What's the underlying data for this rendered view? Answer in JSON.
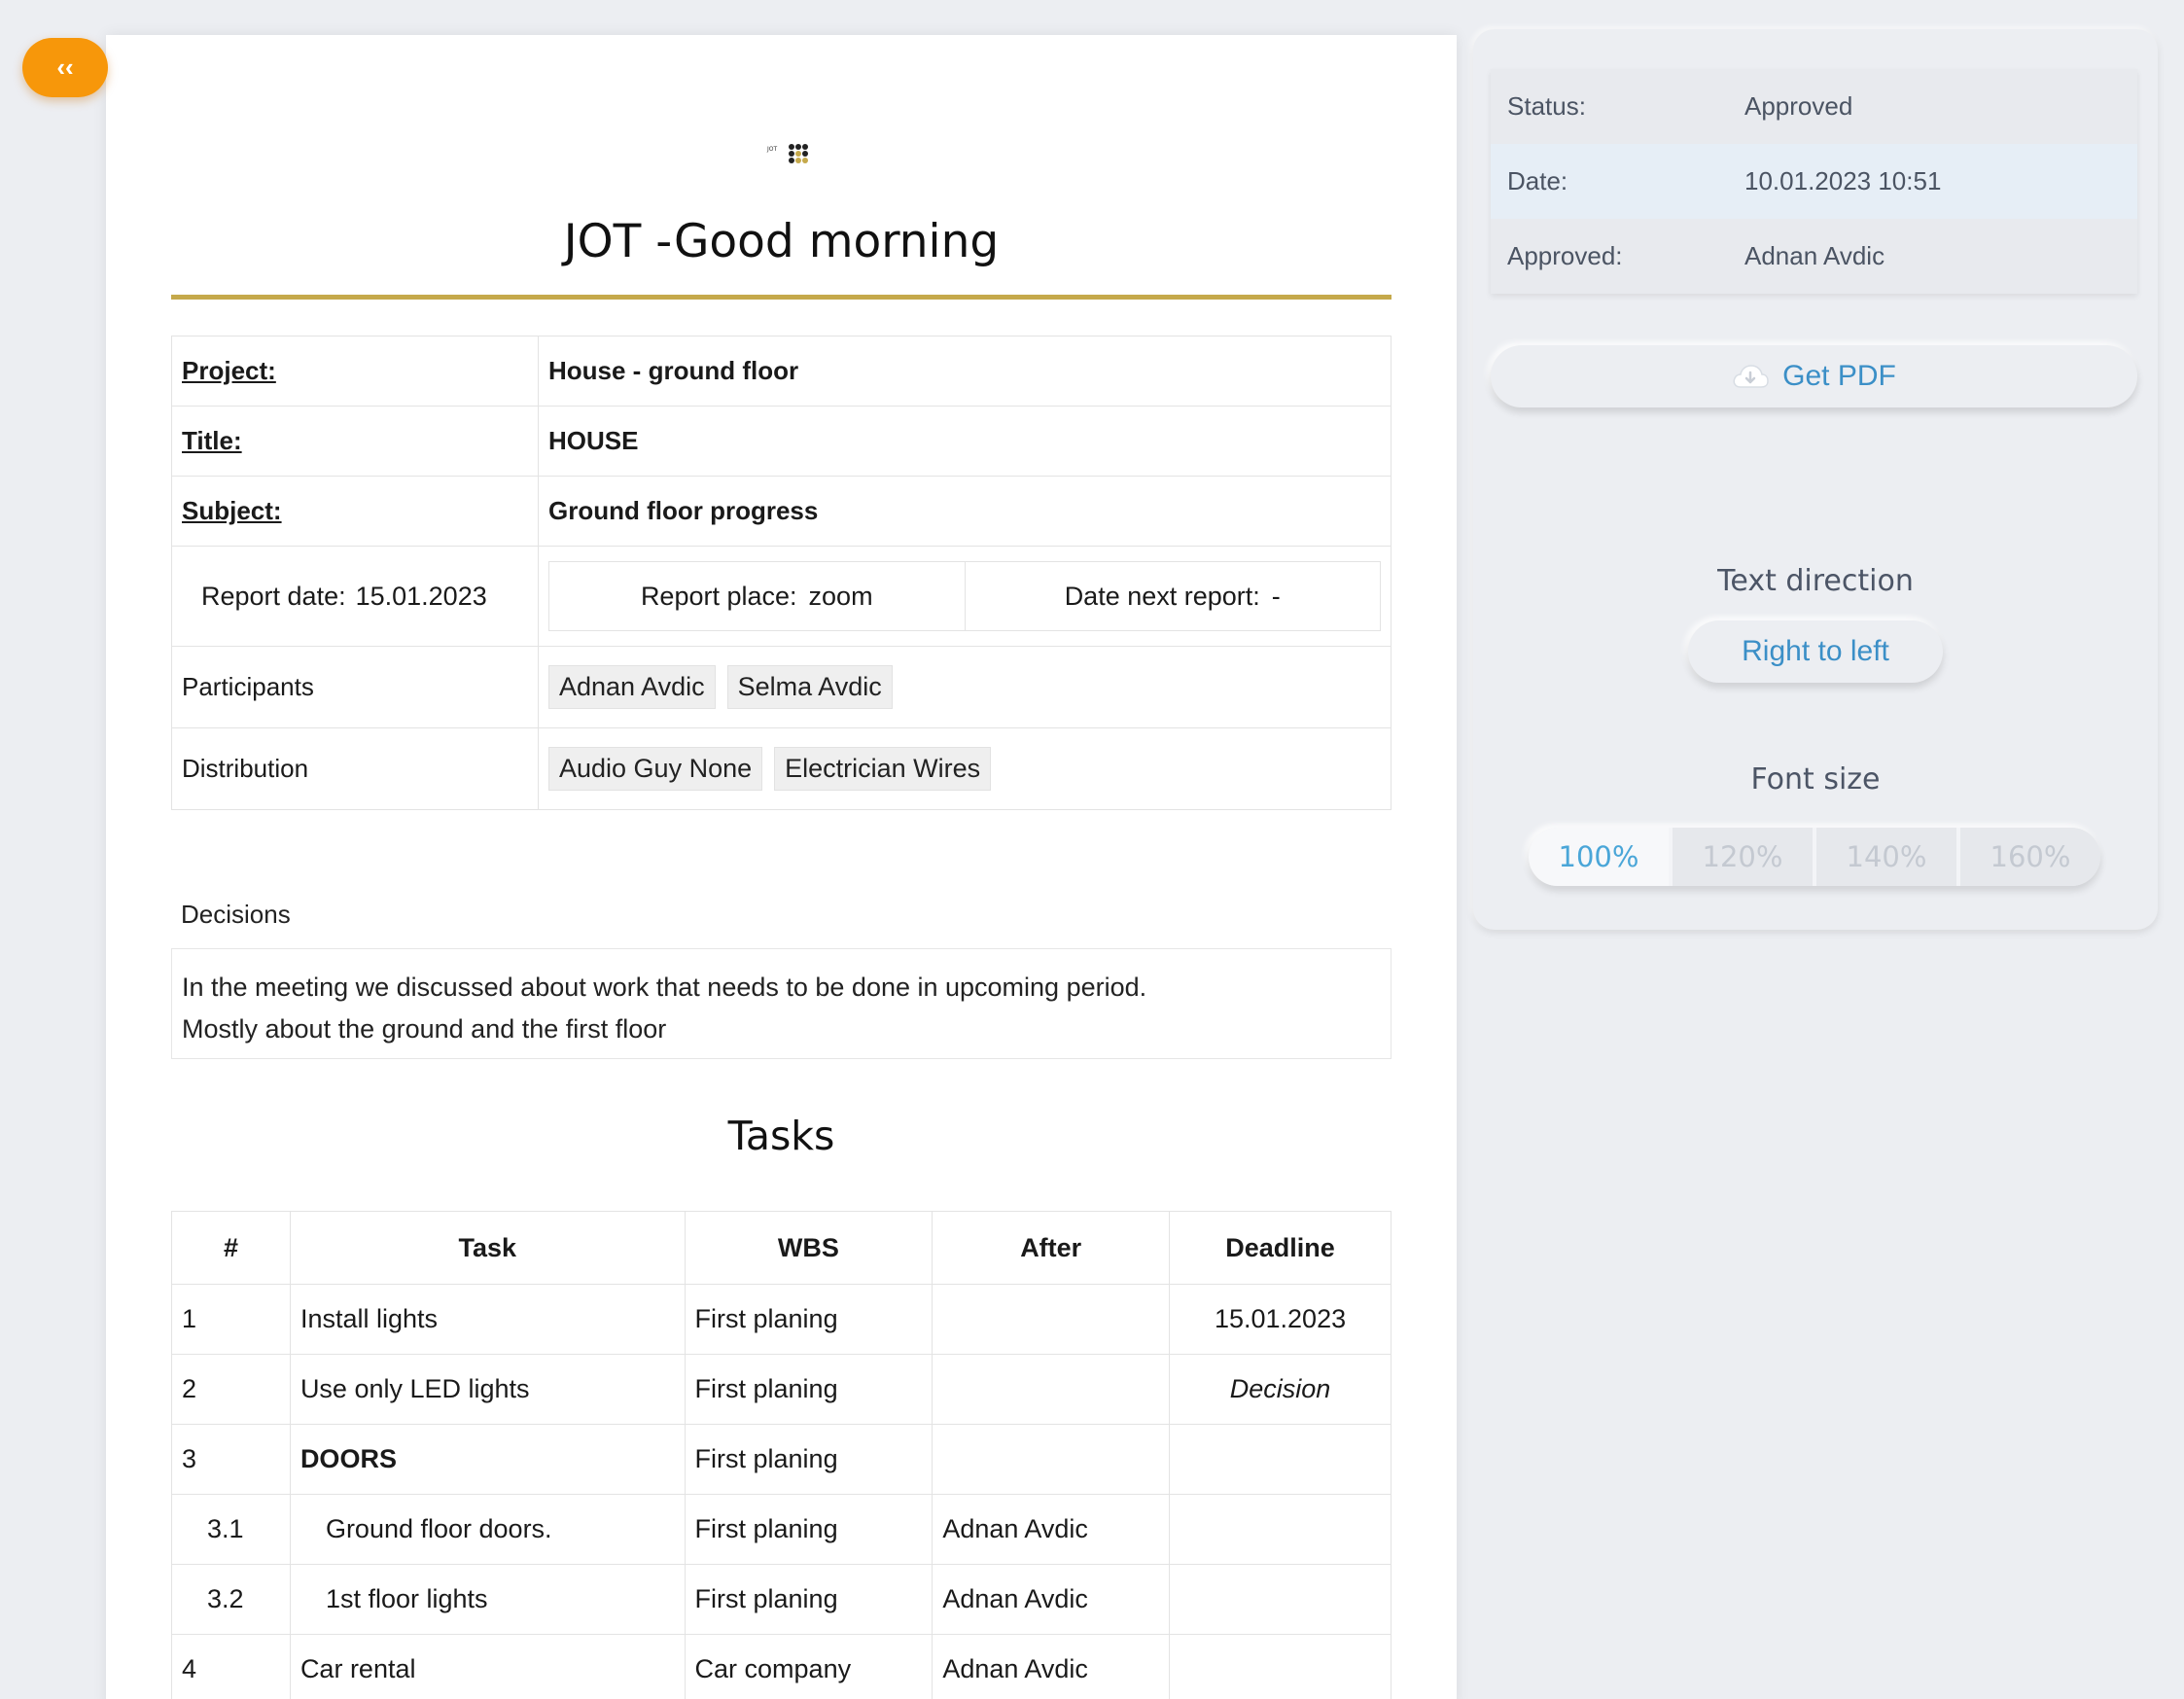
{
  "nav": {
    "back_label": "‹‹"
  },
  "document": {
    "title": "JOT -Good morning",
    "info": {
      "project_label": "Project:",
      "project_value": "House - ground floor",
      "title_label": "Title:",
      "title_value": "HOUSE",
      "subject_label": "Subject:",
      "subject_value": "Ground floor progress",
      "report_date_label": "Report date:",
      "report_date_value": "15.01.2023",
      "report_place_label": "Report place:",
      "report_place_value": "zoom",
      "next_report_label": "Date next report:",
      "next_report_value": "-",
      "participants_label": "Participants",
      "participants": [
        "Adnan Avdic",
        "Selma Avdic"
      ],
      "distribution_label": "Distribution",
      "distribution": [
        "Audio Guy None",
        "Electrician Wires"
      ]
    },
    "decisions": {
      "label": "Decisions",
      "line1": "In the meeting we discussed about work that needs to be done in upcoming period.",
      "line2": "Mostly about the ground and the first floor"
    },
    "tasks": {
      "heading": "Tasks",
      "columns": [
        "#",
        "Task",
        "WBS",
        "After",
        "Deadline"
      ],
      "rows": [
        {
          "num": "1",
          "task": "Install lights",
          "wbs": "First planing",
          "after": "",
          "deadline": "15.01.2023"
        },
        {
          "num": "2",
          "task": "Use only LED lights",
          "wbs": "First planing",
          "after": "",
          "deadline": "Decision"
        },
        {
          "num": "3",
          "task": "DOORS",
          "wbs": "First planing",
          "after": "",
          "deadline": ""
        },
        {
          "num": "3.1",
          "task": "Ground floor doors.",
          "wbs": "First planing",
          "after": "Adnan Avdic",
          "deadline": ""
        },
        {
          "num": "3.2",
          "task": "1st floor lights",
          "wbs": "First planing",
          "after": "Adnan Avdic",
          "deadline": ""
        },
        {
          "num": "4",
          "task": "Car rental",
          "wbs": "Car company",
          "after": "Adnan Avdic",
          "deadline": ""
        }
      ]
    }
  },
  "side_panel": {
    "meta": {
      "status_label": "Status:",
      "status_value": "Approved",
      "date_label": "Date:",
      "date_value": "10.01.2023 10:51",
      "approved_label": "Approved:",
      "approved_value": "Adnan Avdic"
    },
    "pdf_button": "Get PDF",
    "text_direction_title": "Text direction",
    "text_direction_button": "Right to left",
    "font_size_title": "Font size",
    "font_sizes": [
      "100%",
      "120%",
      "140%",
      "160%"
    ],
    "font_size_selected": "100%"
  },
  "colors": {
    "accent_orange": "#f7970a",
    "title_rule_gold": "#c5a94b",
    "link_blue": "#3b8fc7",
    "active_blue": "#4aa6d8"
  },
  "icons": {
    "back": "double-chevron-left-icon",
    "pdf": "cloud-download-icon",
    "logo": "jot-logo"
  }
}
